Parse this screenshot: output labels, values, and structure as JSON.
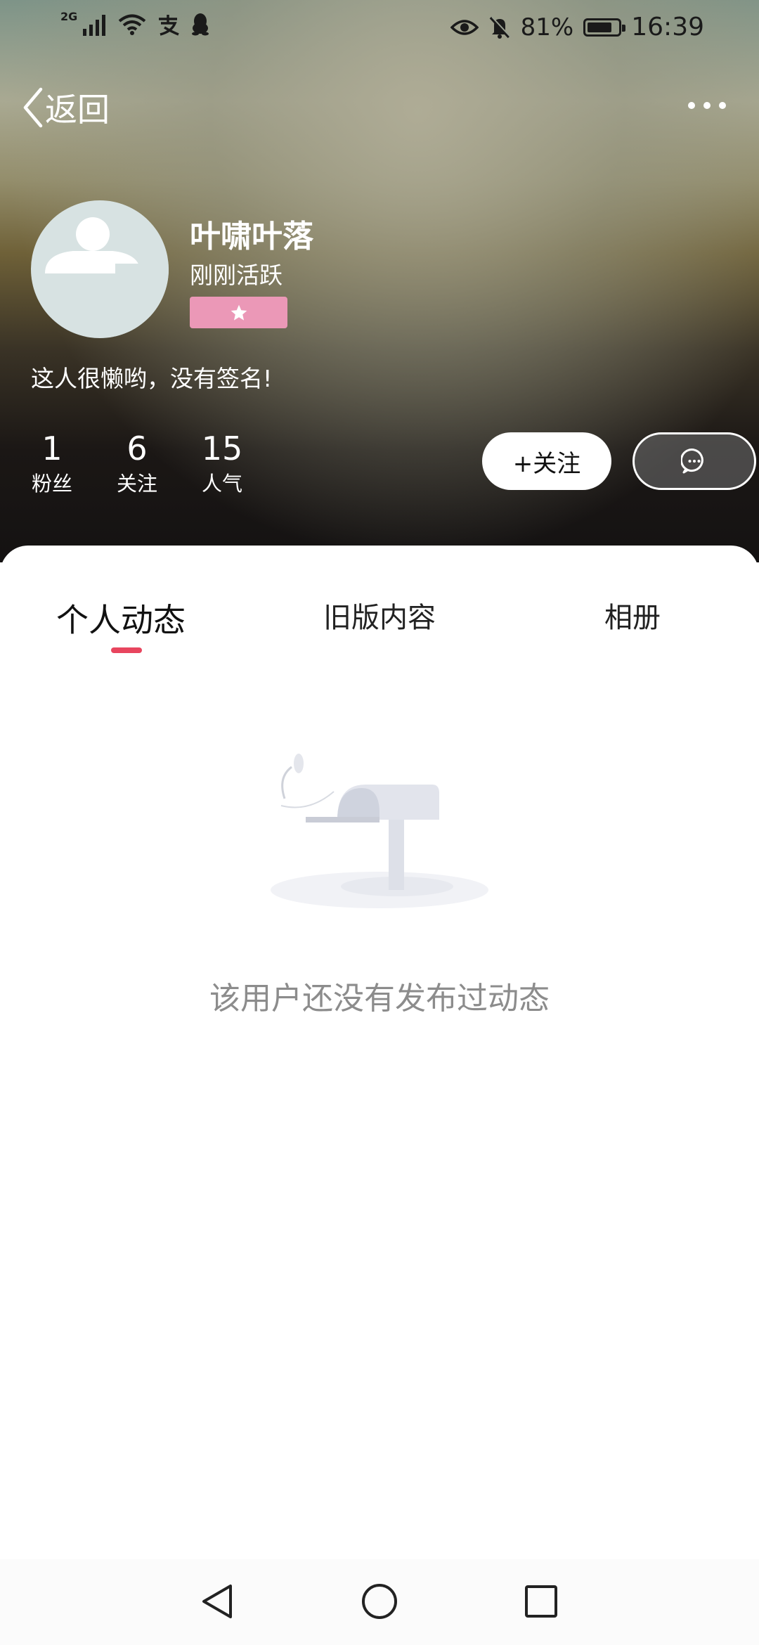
{
  "status_bar": {
    "network_label": "2G",
    "battery_percent": "81%",
    "battery_level": 0.81,
    "time": "16:39"
  },
  "nav": {
    "back_label": "返回"
  },
  "profile": {
    "username": "叶啸叶落",
    "active_status": "刚刚活跃",
    "signature": "这人很懒哟，没有签名!",
    "badge_color": "#eb98b7"
  },
  "stats": [
    {
      "value": "1",
      "label": "粉丝"
    },
    {
      "value": "6",
      "label": "关注"
    },
    {
      "value": "15",
      "label": "人气"
    }
  ],
  "actions": {
    "follow_label": "+关注"
  },
  "tabs": [
    {
      "label": "个人动态",
      "active": true
    },
    {
      "label": "旧版内容",
      "active": false
    },
    {
      "label": "相册",
      "active": false
    }
  ],
  "accent_color": "#e8455e",
  "empty_state": {
    "message": "该用户还没有发布过动态"
  }
}
